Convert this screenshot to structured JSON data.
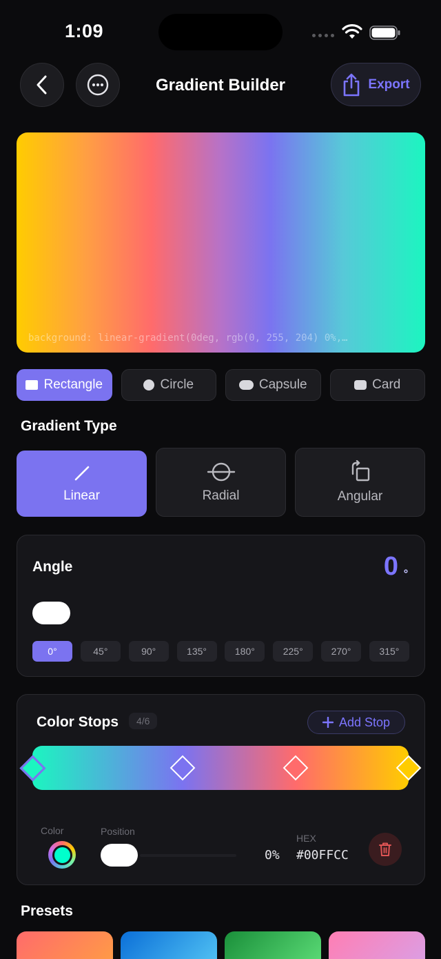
{
  "status_bar": {
    "time": "1:09"
  },
  "nav": {
    "title": "Gradient Builder",
    "export_label": "Export"
  },
  "preview": {
    "code": "background: linear-gradient(0deg, rgb(0, 255, 204) 0%,…",
    "colors": [
      "#ffcc00",
      "#ff9f43",
      "#ff6b6b",
      "#7b73f0",
      "#1cf5c0"
    ]
  },
  "shapes": [
    {
      "label": "Rectangle",
      "icon": "rectangle-icon",
      "active": true
    },
    {
      "label": "Circle",
      "icon": "circle-icon",
      "active": false
    },
    {
      "label": "Capsule",
      "icon": "capsule-icon",
      "active": false
    },
    {
      "label": "Card",
      "icon": "card-icon",
      "active": false
    }
  ],
  "gradient_type": {
    "title": "Gradient Type",
    "options": [
      {
        "label": "Linear",
        "icon": "linear-icon",
        "active": true
      },
      {
        "label": "Radial",
        "icon": "radial-icon",
        "active": false
      },
      {
        "label": "Angular",
        "icon": "angular-icon",
        "active": false
      }
    ]
  },
  "angle": {
    "label": "Angle",
    "value": "0",
    "unit": "°",
    "presets": [
      "0°",
      "45°",
      "90°",
      "135°",
      "180°",
      "225°",
      "270°",
      "315°"
    ],
    "active_preset": "0°"
  },
  "color_stops": {
    "title": "Color Stops",
    "count": "4/6",
    "add_label": "Add Stop",
    "stops": [
      {
        "color": "#1CF5C0",
        "position_fraction": 0.0,
        "selected": true
      },
      {
        "color": "#7B73F0",
        "position_fraction": 0.4,
        "selected": false
      },
      {
        "color": "#FF6B6B",
        "position_fraction": 0.7,
        "selected": false
      },
      {
        "color": "#FFCC00",
        "position_fraction": 1.0,
        "selected": false
      }
    ],
    "editor": {
      "color_label": "Color",
      "position_label": "Position",
      "hex_label": "HEX",
      "position_value": "0%",
      "hex_value": "#00FFCC"
    }
  },
  "presets": {
    "title": "Presets",
    "swatches": [
      [
        "#ff6b6b",
        "#ff9f43"
      ],
      [
        "#0b6fd8",
        "#56c8f5"
      ],
      [
        "#1a8f3a",
        "#5fe07a"
      ],
      [
        "#ff7eb3",
        "#d8a1e8"
      ]
    ]
  },
  "colors": {
    "accent": "#7B73F0",
    "danger": "#E05555"
  }
}
